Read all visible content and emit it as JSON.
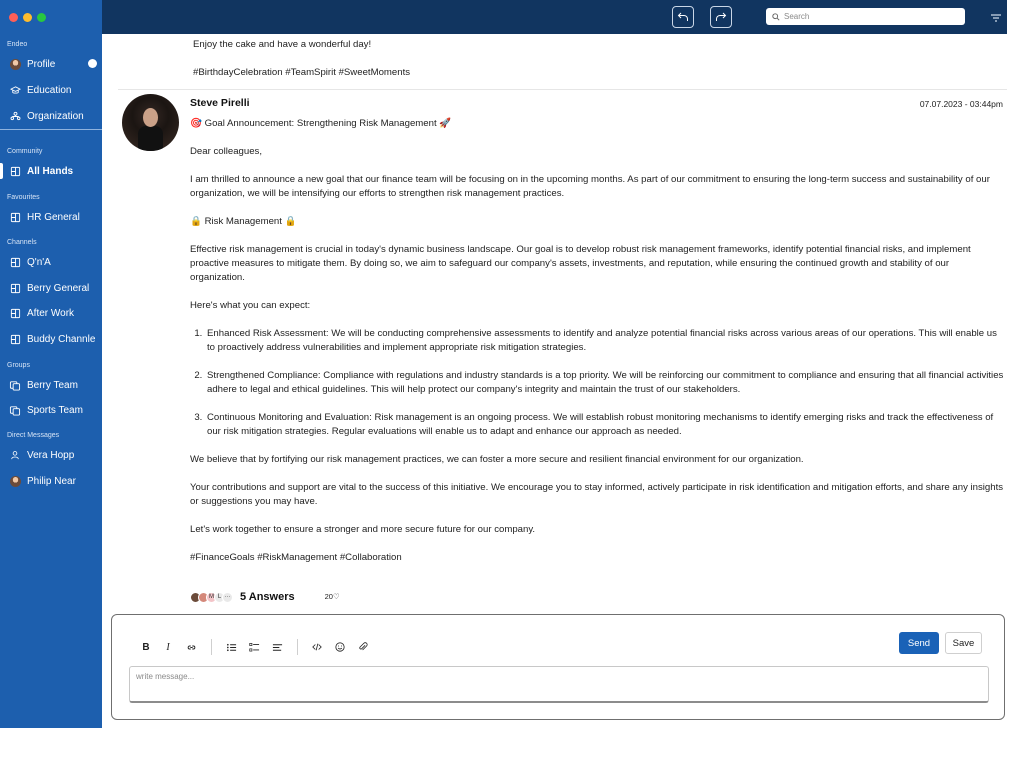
{
  "window": {
    "traffic_colors": [
      "#ff5f57",
      "#febc2e",
      "#28c840"
    ]
  },
  "sidebar": {
    "sections": {
      "endeo": "Endeo",
      "community": "Community",
      "favourites": "Favourites",
      "channels": "Channels",
      "groups": "Groups",
      "direct_messages": "Direct Messages"
    },
    "items": {
      "profile": "Profile",
      "education": "Education",
      "organization": "Organization",
      "all_hands": "All Hands",
      "hr_general": "HR General",
      "qna": "Q'n'A",
      "berry_general": "Berry General",
      "after_work": "After Work",
      "buddy_channle": "Buddy Channle",
      "berry_team": "Berry Team",
      "sports_team": "Sports Team",
      "vera_hopp": "Vera Hopp",
      "philip_near": "Philip Near"
    },
    "colors": {
      "background": "#1d5fae",
      "topbar": "#113560"
    }
  },
  "topbar": {
    "search_placeholder": "Search"
  },
  "previous_post": {
    "line1": "Enjoy the cake and have a wonderful day!",
    "line2": "#BirthdayCelebration #TeamSpirit #SweetMoments"
  },
  "post": {
    "author": "Steve Pirelli",
    "date": "07.07.2023 - 03:44pm",
    "title": "🎯 Goal Announcement: Strengthening Risk Management 🚀",
    "greeting": "Dear colleagues,",
    "intro": "I am thrilled to announce a new goal that our finance team will be focusing on in the upcoming months. As part of our commitment to ensuring the long-term success and sustainability of our organization, we will be intensifying our efforts to strengthen risk management practices.",
    "section_heading": "🔒 Risk Management 🔒",
    "section_body": "Effective risk management is crucial in today's dynamic business landscape. Our goal is to develop robust risk management frameworks, identify potential financial risks, and implement proactive measures to mitigate them. By doing so, we aim to safeguard our company's assets, investments, and reputation, while ensuring the continued growth and stability of our organization.",
    "expect_intro": "Here's what you can expect:",
    "list": [
      "Enhanced Risk Assessment: We will be conducting comprehensive assessments to identify and analyze potential financial risks across various areas of our operations. This will enable us to proactively address vulnerabilities and implement appropriate risk mitigation strategies.",
      "Strengthened Compliance: Compliance with regulations and industry standards is a top priority. We will be reinforcing our commitment to compliance and ensuring that all financial activities adhere to legal and ethical guidelines. This will help protect our company's integrity and maintain the trust of our stakeholders.",
      "Continuous Monitoring and Evaluation: Risk management is an ongoing process. We will establish robust monitoring mechanisms to identify emerging risks and track the effectiveness of our risk mitigation strategies. Regular evaluations will enable us to adapt and enhance our approach as needed."
    ],
    "belief": "We believe that by fortifying our risk management practices, we can foster a more secure and resilient financial environment for our organization.",
    "contributions": "Your contributions and support are vital to the success of this initiative. We encourage you to stay informed, actively participate in risk identification and mitigation efforts, and share any insights or suggestions you may have.",
    "closing": "Let's work together to ensure a stronger and more secure future for our company.",
    "hashtags": "#FinanceGoals #RiskManagement #Collaboration",
    "answer_avatars": [
      "",
      "",
      "M",
      "L",
      "···"
    ],
    "answers_label": "5 Answers",
    "likes": "20",
    "heart": "♡"
  },
  "editor": {
    "bold": "B",
    "italic": "I",
    "send_label": "Send",
    "save_label": "Save",
    "placeholder": "write message..."
  }
}
